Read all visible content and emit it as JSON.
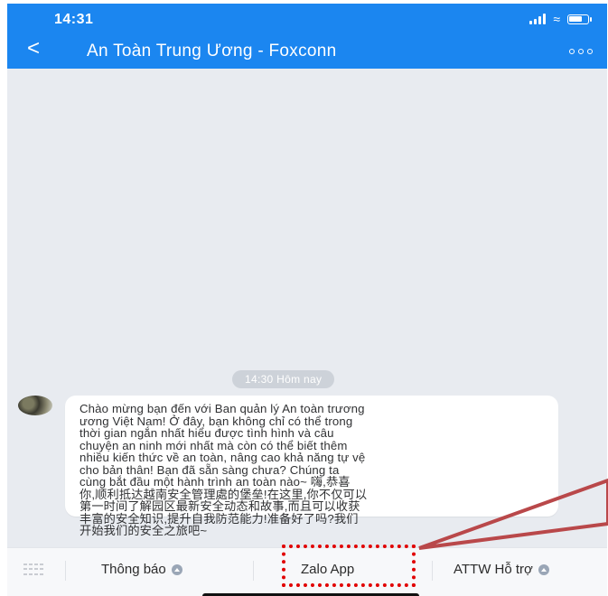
{
  "status_bar": {
    "time": "14:31"
  },
  "header": {
    "back_glyph": "<",
    "title": "An Toàn Trung Ương - Foxconn",
    "more_icon": "more-icon"
  },
  "chat": {
    "timestamp": "14:30 Hôm nay",
    "messages": [
      {
        "sender": "An Toàn Trung Ương - Foxconn",
        "lines": [
          "Chào mừng bạn đến với Ban quản lý An toàn trương",
          "ương Việt Nam! Ở đây, bạn không chỉ có thể trong",
          "thời gian ngắn nhất hiểu được tình hình và câu",
          "chuyện an ninh mới nhất mà còn có thể biết thêm",
          "nhiều kiến thức về an toàn, nâng cao khả năng tự vệ",
          "cho bản thân! Bạn đã sẵn sàng chưa? Chúng ta",
          "cùng bắt đầu một hành trình an toàn nào~ 嗨,恭喜",
          "你,顺利抵达越南安全管理處的堡垒!在这里,你不仅可以",
          "第一时间了解园区最新安全动态和故事,而且可以收获",
          "丰富的安全知识,提升自我防范能力!准备好了吗?我们",
          "开始我们的安全之旅吧~"
        ]
      }
    ]
  },
  "menu": {
    "keyboard_icon": "keyboard-icon",
    "items": [
      {
        "label": "Thông báo"
      },
      {
        "label": "Zalo App"
      },
      {
        "label": "ATTW Hỗ trợ"
      }
    ]
  },
  "colors": {
    "header": "#1b86f0",
    "highlight": "#e10000",
    "callout": "#b9484a",
    "chat_bg": "#e8ebf0"
  }
}
